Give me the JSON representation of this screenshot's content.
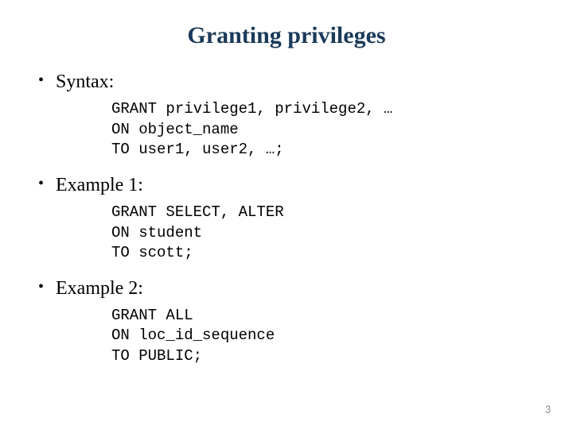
{
  "title": "Granting privileges",
  "sections": [
    {
      "label": "Syntax:",
      "code": "GRANT privilege1, privilege2, …\nON object_name\nTO user1, user2, …;"
    },
    {
      "label": "Example 1:",
      "code": "GRANT SELECT, ALTER\nON student\nTO scott;"
    },
    {
      "label": "Example 2:",
      "code": "GRANT ALL\nON loc_id_sequence\nTO PUBLIC;"
    }
  ],
  "page_number": "3"
}
